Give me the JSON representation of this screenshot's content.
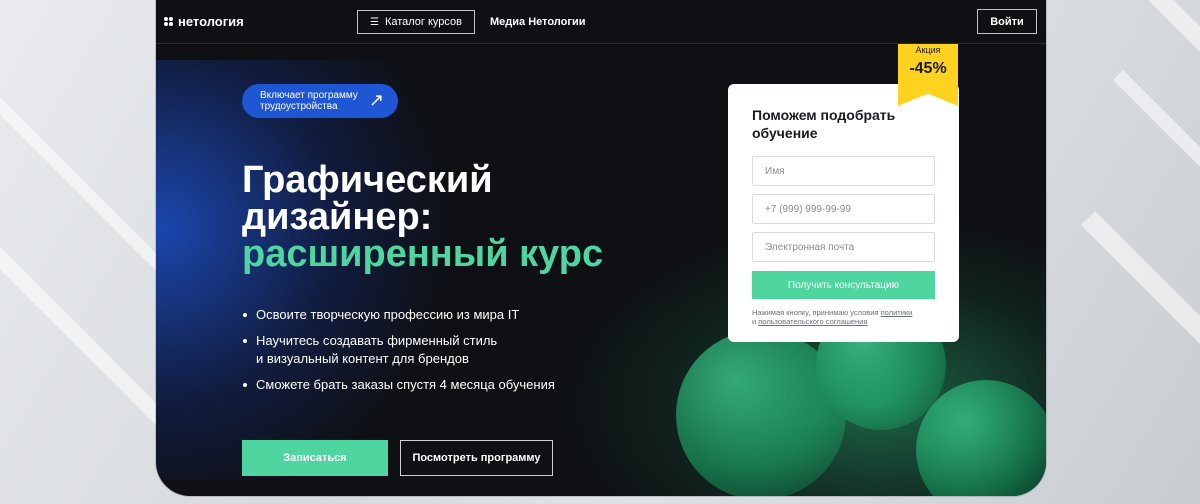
{
  "header": {
    "logo_text": "нетология",
    "catalog_label": "Каталог курсов",
    "media_label": "Медиа Нетологии",
    "login_label": "Войти"
  },
  "hero": {
    "badge_line1": "Включает программу",
    "badge_line2": "трудоустройства",
    "title_line1": "Графический",
    "title_line2": "дизайнер:",
    "title_accent": "расширенный курс",
    "bullets": [
      "Освоите творческую профессию из мира IT",
      "Научитесь создавать фирменный стиль",
      "и визуальный контент для брендов",
      "Сможете брать заказы спустя 4 месяца обучения"
    ],
    "enroll_label": "Записаться",
    "program_label": "Посмотреть программу"
  },
  "form": {
    "title": "Поможем подобрать обучение",
    "name_placeholder": "Имя",
    "phone_placeholder": "+7 (999) 999-99-99",
    "email_placeholder": "Электронная почта",
    "submit_label": "Получить консультацию",
    "legal_prefix": "Нажимая кнопку, принимаю условия",
    "legal_link1": "политики",
    "legal_and": "и",
    "legal_link2": "пользовательского соглашения"
  },
  "sale": {
    "label": "Акция",
    "value": "-45%"
  },
  "colors": {
    "accent_green": "#4fd6a0",
    "badge_blue": "#1f56d4",
    "sale_yellow": "#ffd21f"
  }
}
